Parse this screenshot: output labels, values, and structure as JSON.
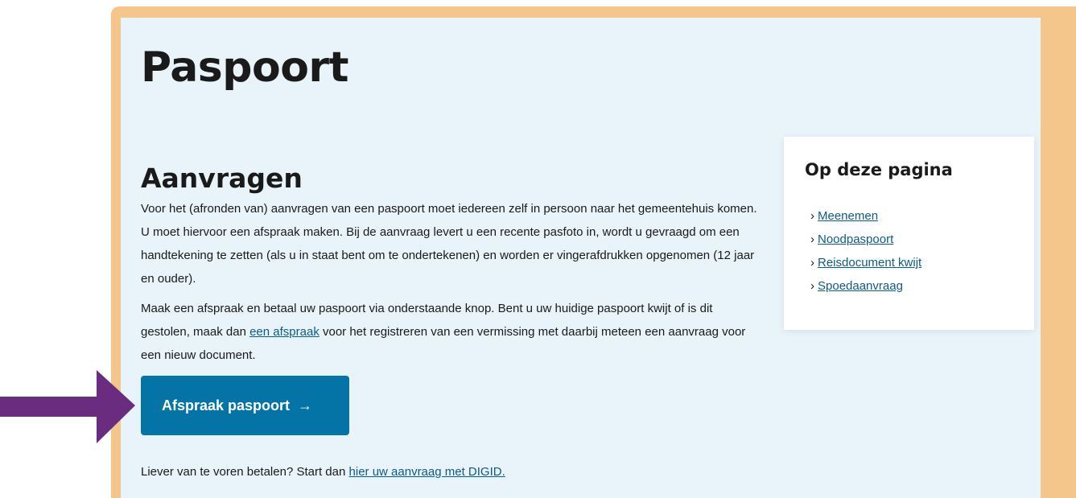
{
  "page": {
    "title": "Paspoort",
    "section_title": "Aanvragen",
    "paragraph1": "Voor het (afronden van) aanvragen van een paspoort moet iedereen zelf in persoon naar het gemeentehuis komen. U moet hiervoor een afspraak maken. Bij de aanvraag levert u een recente pasfoto in, wordt u gevraagd om een handtekening te zetten (als u in staat bent om te ondertekenen) en worden er vingerafdrukken opgenomen (12 jaar en ouder).",
    "paragraph2_before": "Maak een afspraak en betaal uw paspoort via onderstaande knop. Bent u uw huidige paspoort kwijt of is dit gestolen, maak dan ",
    "paragraph2_link": "een afspraak",
    "paragraph2_after": " voor het registreren van een vermissing met daarbij meteen een aanvraag voor een nieuw document.",
    "cta_label": "Afspraak paspoort",
    "cta_arrow": "→",
    "footer_before": "Liever van te voren betalen? Start dan ",
    "footer_link": "hier uw aanvraag met DIGID."
  },
  "toc": {
    "title": "Op deze pagina",
    "chevron": "›",
    "items": [
      {
        "label": "Meenemen"
      },
      {
        "label": "Noodpaspoort"
      },
      {
        "label": "Reisdocument kwijt"
      },
      {
        "label": "Spoedaanvraag"
      }
    ]
  },
  "colors": {
    "frame": "#f5c68c",
    "panel": "#e8f3fa",
    "button": "#0473a6",
    "link": "#0b5c8c",
    "annotation_arrow": "#6a2c7e"
  },
  "annotation": {
    "icon": "purple-arrow-right-icon"
  }
}
